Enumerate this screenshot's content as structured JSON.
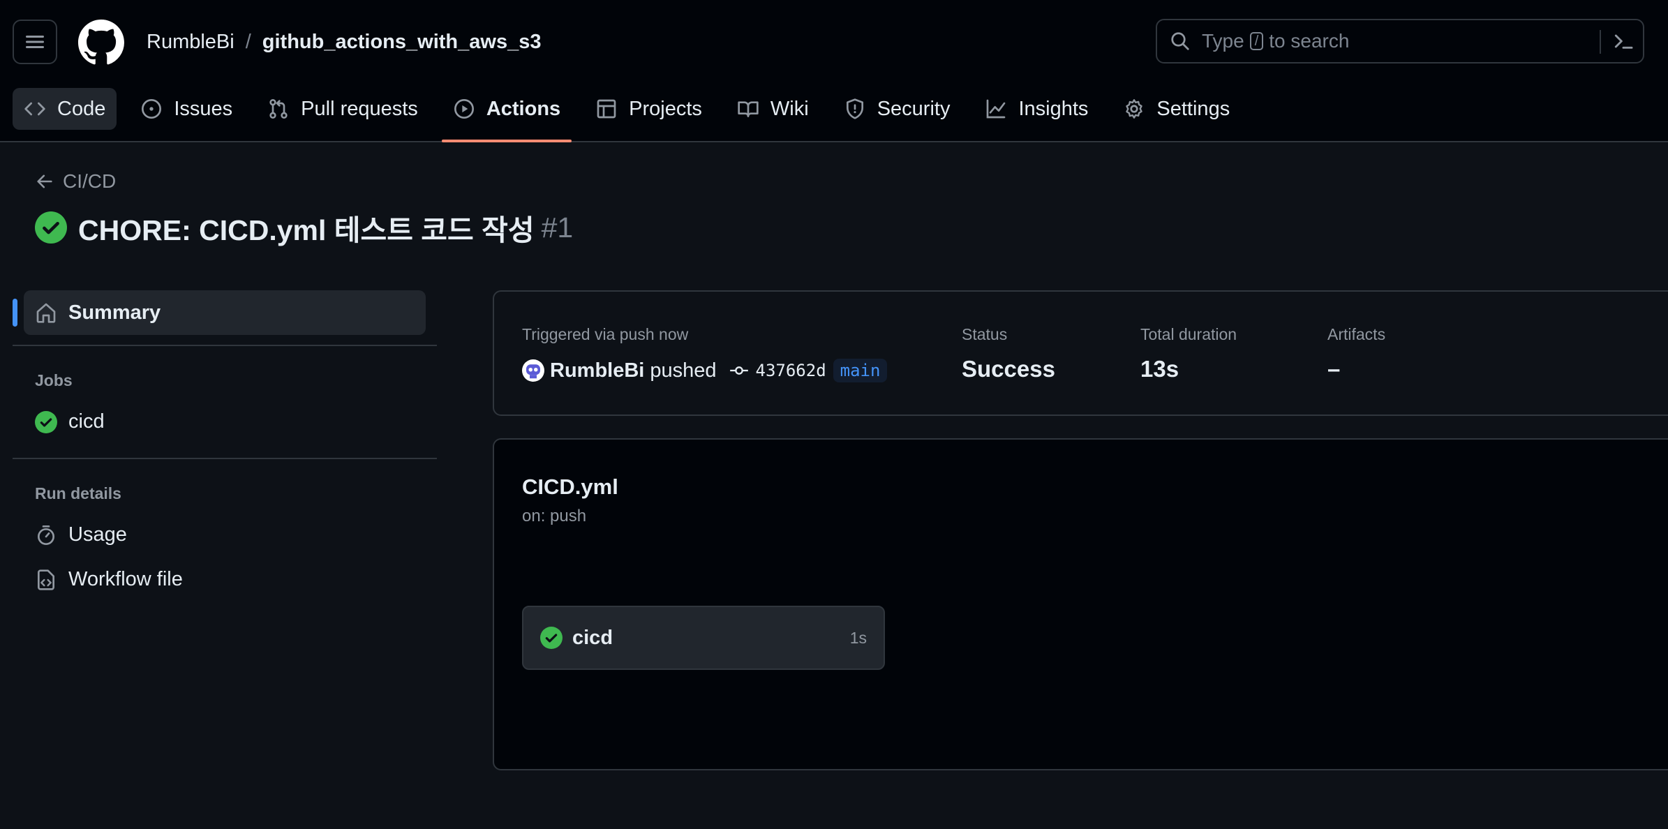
{
  "header": {
    "repo_owner": "RumbleBi",
    "repo_separator": "/",
    "repo_name": "github_actions_with_aws_s3",
    "search": {
      "prefix": "Type",
      "key": "/",
      "suffix": "to search"
    },
    "nav": [
      {
        "label": "Code",
        "icon": "code-icon"
      },
      {
        "label": "Issues",
        "icon": "issue-icon"
      },
      {
        "label": "Pull requests",
        "icon": "pull-request-icon"
      },
      {
        "label": "Actions",
        "icon": "play-icon",
        "active": true
      },
      {
        "label": "Projects",
        "icon": "table-icon"
      },
      {
        "label": "Wiki",
        "icon": "book-icon"
      },
      {
        "label": "Security",
        "icon": "shield-icon"
      },
      {
        "label": "Insights",
        "icon": "graph-icon"
      },
      {
        "label": "Settings",
        "icon": "gear-icon"
      }
    ]
  },
  "run": {
    "back_label": "CI/CD",
    "title": "CHORE: CICD.yml 테스트 코드 작성",
    "number": "#1",
    "status_color": "#3fb950"
  },
  "sidebar": {
    "summary_label": "Summary",
    "jobs_heading": "Jobs",
    "jobs": [
      {
        "label": "cicd"
      }
    ],
    "run_details_heading": "Run details",
    "details": [
      {
        "label": "Usage",
        "icon": "stopwatch-icon"
      },
      {
        "label": "Workflow file",
        "icon": "file-code-icon"
      }
    ]
  },
  "summary": {
    "trigger_label": "Triggered via push now",
    "user": "RumbleBi",
    "action": "pushed",
    "commit": "437662d",
    "branch": "main",
    "status_label": "Status",
    "status_value": "Success",
    "duration_label": "Total duration",
    "duration_value": "13s",
    "artifacts_label": "Artifacts",
    "artifacts_value": "–"
  },
  "workflow": {
    "name": "CICD.yml",
    "trigger": "on: push",
    "job": {
      "name": "cicd",
      "duration": "1s"
    }
  },
  "colors": {
    "accent_blue": "#4493f8",
    "success_green": "#3fb950",
    "active_tab_underline": "#fd8c73"
  }
}
